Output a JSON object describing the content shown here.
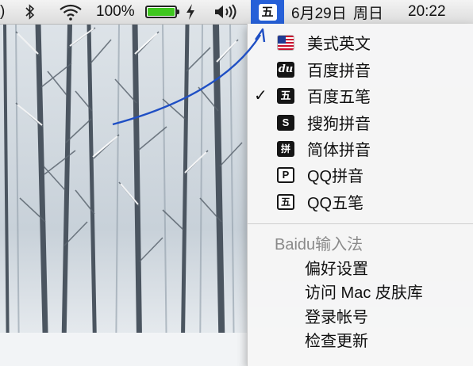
{
  "menubar": {
    "bluetooth_icon": "bluetooth-icon",
    "wifi_icon": "wifi-icon",
    "battery_percent_text": "100%",
    "battery_level": 1.0,
    "battery_fill_color": "#3ec61f",
    "charging_icon": "bolt-icon",
    "volume_icon": "speaker-icon",
    "input_method_badge": "五",
    "active_highlight_color": "#2660d8",
    "date": "6月29日",
    "weekday": "周日",
    "time": "20:22"
  },
  "input_menu": {
    "items": [
      {
        "label": "美式英文",
        "icon": "us-flag-icon",
        "checked": false
      },
      {
        "label": "百度拼音",
        "icon_text": "du",
        "checked": false
      },
      {
        "label": "百度五笔",
        "icon_text": "五",
        "checked": true,
        "check_mark": "✓"
      },
      {
        "label": "搜狗拼音",
        "icon_text": "S",
        "checked": false
      },
      {
        "label": "简体拼音",
        "icon_text": "拼",
        "checked": false
      },
      {
        "label": "QQ拼音",
        "icon_text": "P",
        "checked": false
      },
      {
        "label": "QQ五笔",
        "icon_text": "五",
        "checked": false
      }
    ],
    "section_title": "Baidu输入法",
    "actions": [
      "偏好设置",
      "访问 Mac 皮肤库",
      "登录帐号",
      "检查更新"
    ]
  },
  "annotation": {
    "arrow_color": "#1f4fc4"
  }
}
